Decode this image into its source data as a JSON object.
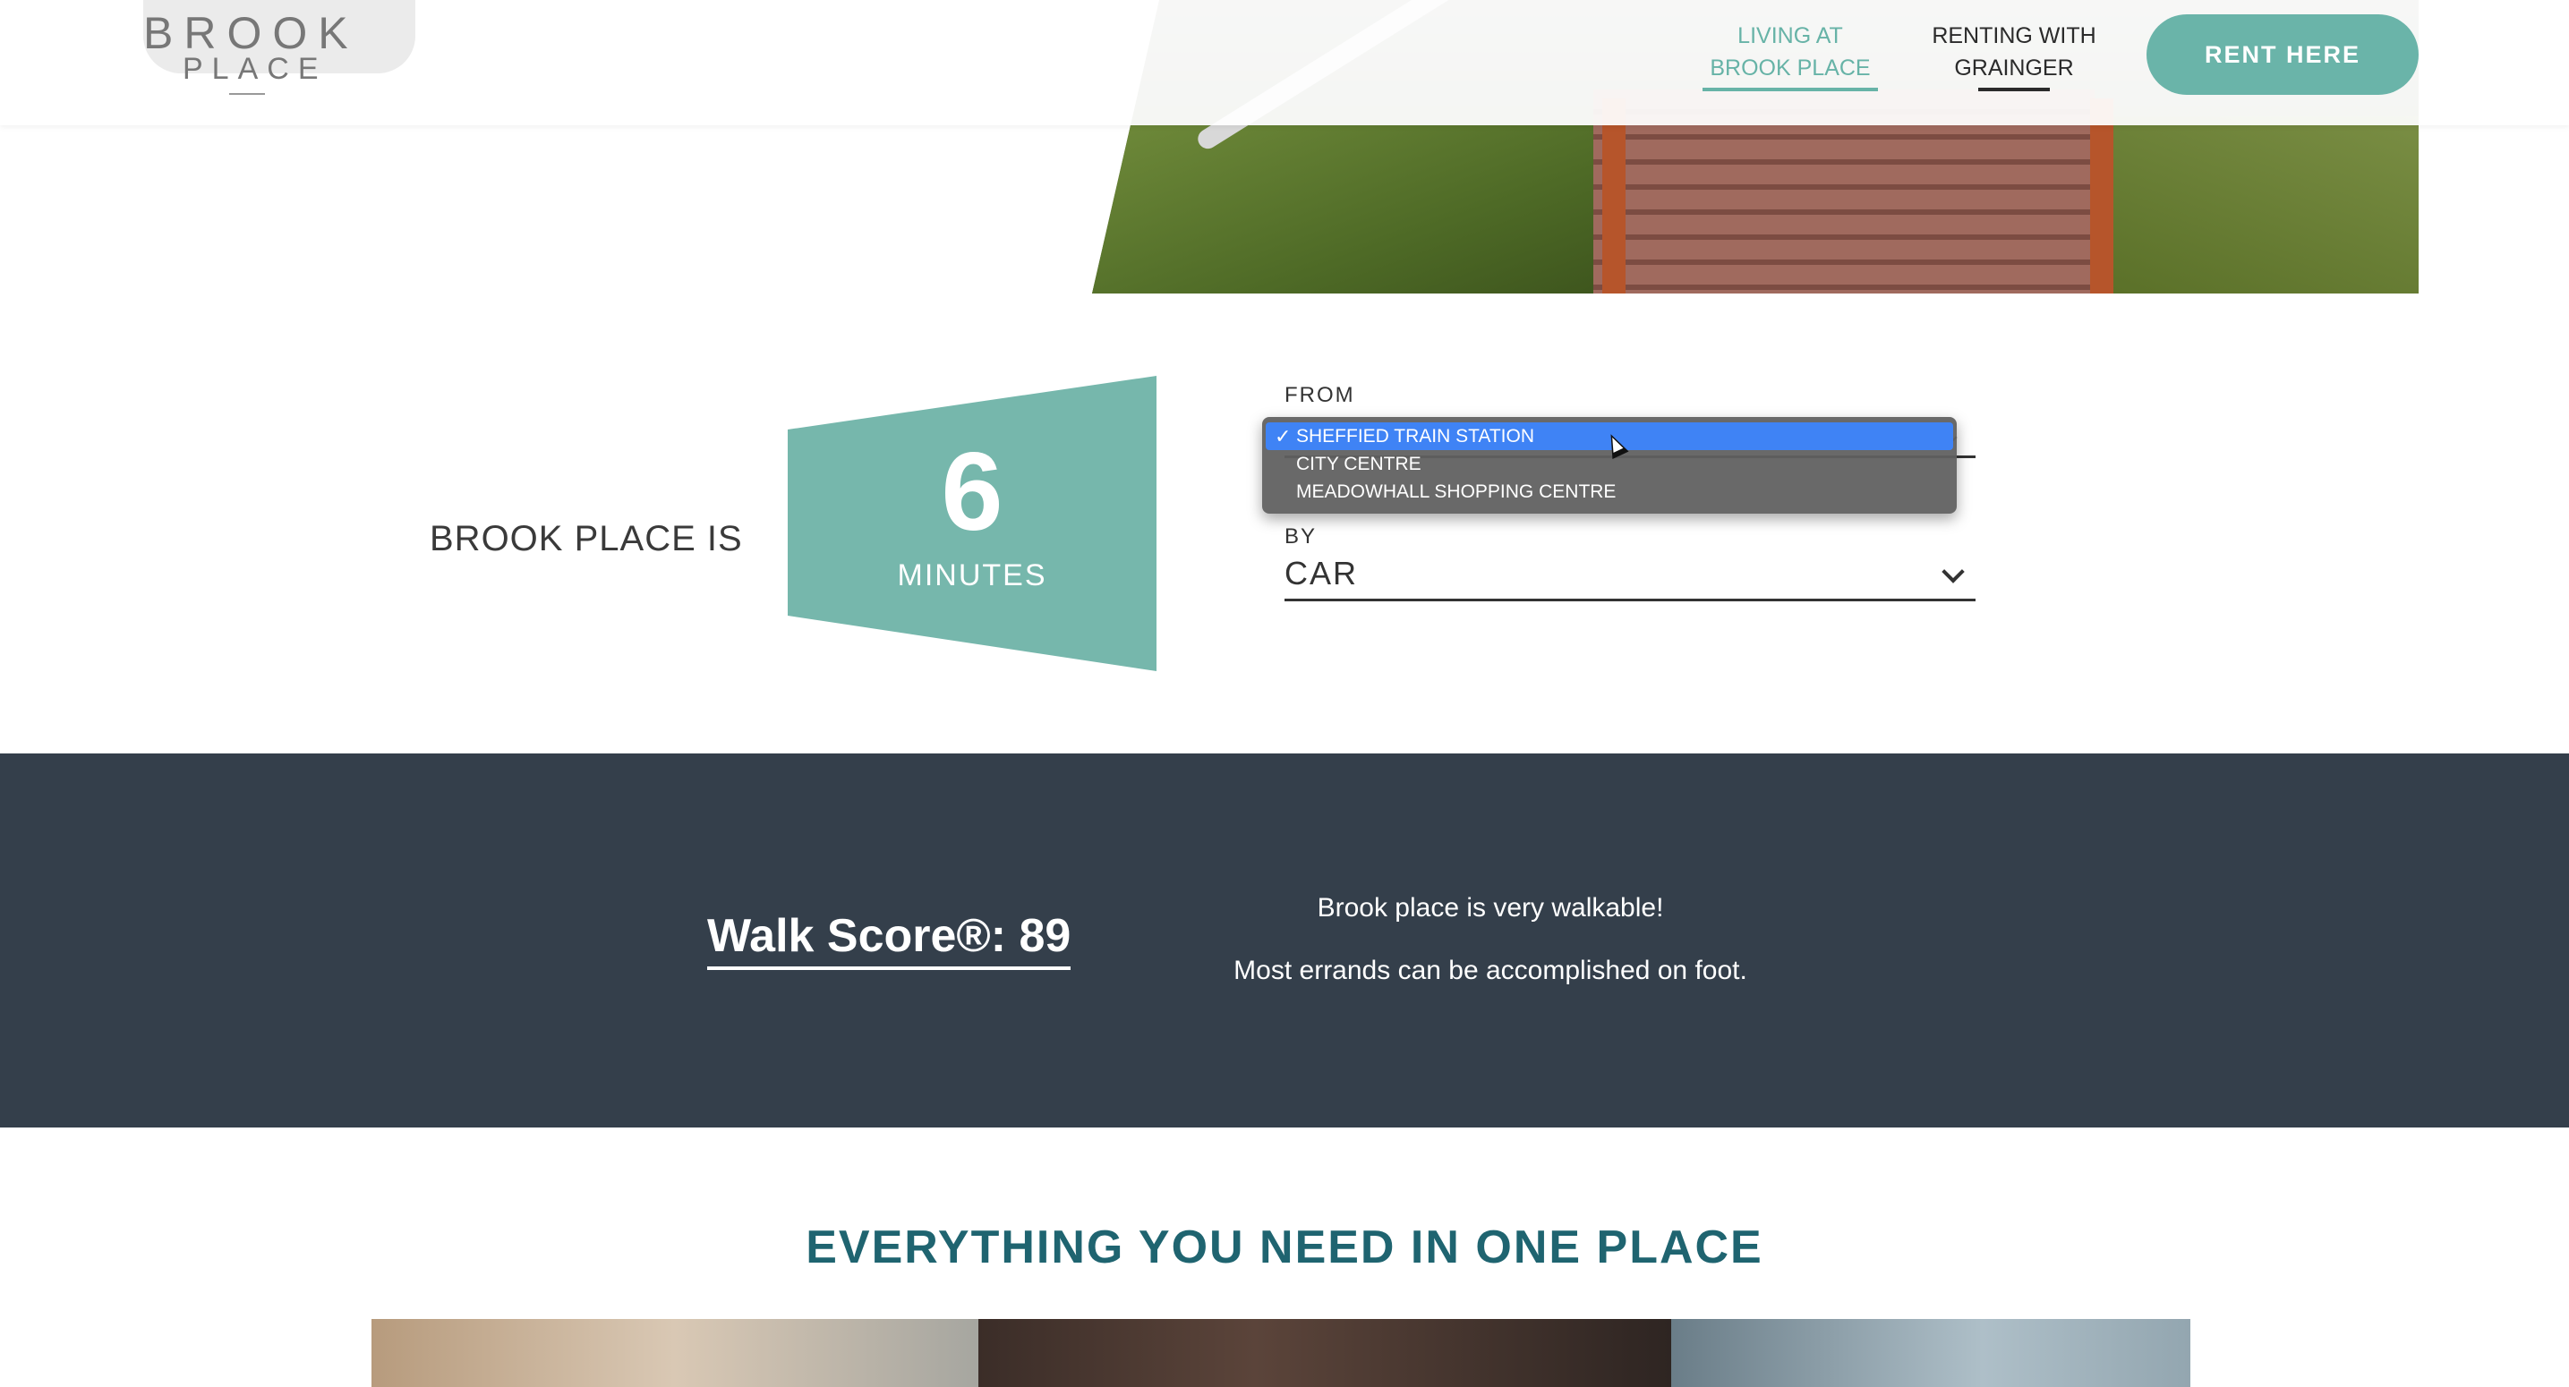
{
  "header": {
    "logo_top": "BROOK",
    "logo_bottom": "PLACE",
    "nav": [
      {
        "line1": "LIVING AT",
        "line2": "BROOK PLACE"
      },
      {
        "line1": "RENTING WITH",
        "line2": "GRAINGER"
      }
    ],
    "cta": "RENT HERE"
  },
  "journey": {
    "prefix": "BROOK PLACE IS",
    "minutes": "6",
    "minutes_label": "MINUTES",
    "from_label": "FROM",
    "by_label": "BY",
    "by_value": "CAR",
    "from_options": [
      {
        "label": "SHEFFIED TRAIN STATION",
        "selected": true
      },
      {
        "label": "CITY CENTRE",
        "selected": false
      },
      {
        "label": "MEADOWHALL SHOPPING CENTRE",
        "selected": false
      }
    ],
    "check_mark": "✓"
  },
  "walk": {
    "score": "Walk Score®: 89",
    "line1": "Brook place is very walkable!",
    "line2": "Most errands can be accomplished on foot."
  },
  "everything": {
    "heading": "EVERYTHING YOU NEED IN ONE PLACE"
  },
  "colors": {
    "accent": "#67b3a7",
    "dark_band": "#343f4b",
    "heading": "#1f6470",
    "select_highlight": "#3f83f5"
  }
}
